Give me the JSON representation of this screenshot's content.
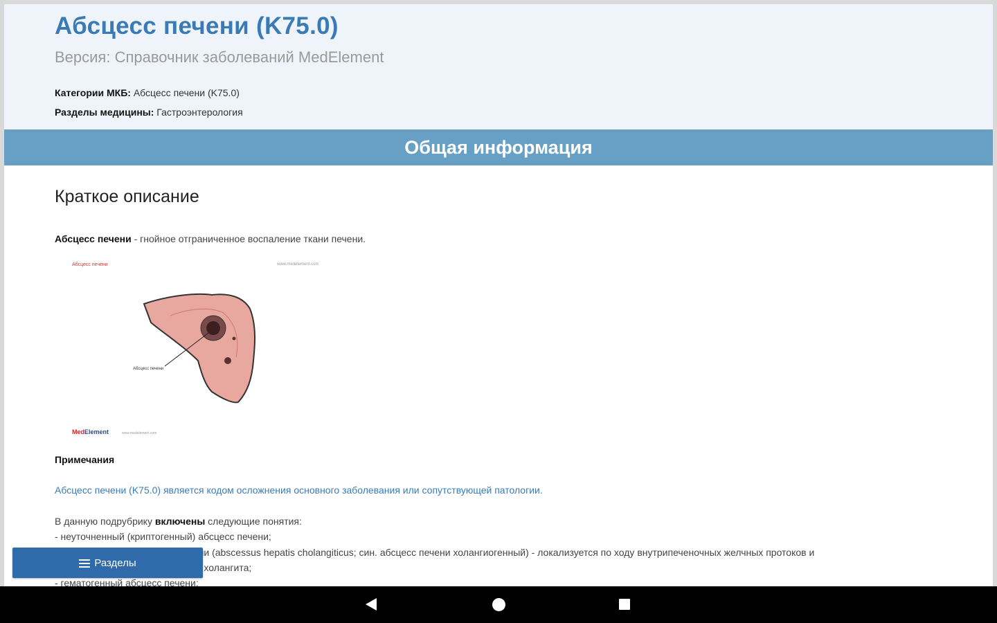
{
  "header": {
    "title": "Абсцесс печени (K75.0)",
    "subtitle": "Версия: Справочник заболеваний MedElement",
    "icd_label": "Категории МКБ:",
    "icd_value": "Абсцесс печени (K75.0)",
    "sections_label": "Разделы медицины:",
    "sections_value": "Гастроэнтерология"
  },
  "band": {
    "title": "Общая информация"
  },
  "content": {
    "heading": "Краткое описание",
    "definition_term": "Абсцесс печени",
    "definition_text": " - гнойное отграниченное воспаление ткани печени.",
    "figure": {
      "label_top_left": "Абсцесс печени",
      "label_top_right": "www.medelement.com",
      "label_pointer": "Абсцесс печени",
      "logo_med": "Med",
      "logo_element": "Element",
      "logo_sub": "www.medelement.com"
    },
    "notes_heading": "Примечания",
    "notes_link": "Абсцесс печени (K75.0) является кодом осложнения основного заболевания или сопутствующей патологии.",
    "included_prefix": "В данную подрубрику ",
    "included_bold": "включены",
    "included_suffix": " следующие понятия:",
    "list": [
      "-  неуточненный (криптогенный) абсцесс печени;",
      "-  холангитический абсцесс печени (abscessus hepatis cholangiticus; син. абсцесс печени холангиогенный) - локализуется по ходу внутрипеченочных желчных протоков и",
      "   является осложнением гнойного холангита;",
      "-  гематогенный абсцесс печени;"
    ]
  },
  "sections_button": {
    "label": "Разделы",
    "icon": "menu-icon"
  },
  "navbar": {
    "back_icon": "back-triangle-icon",
    "home_icon": "home-circle-icon",
    "recent_icon": "recent-square-icon"
  }
}
